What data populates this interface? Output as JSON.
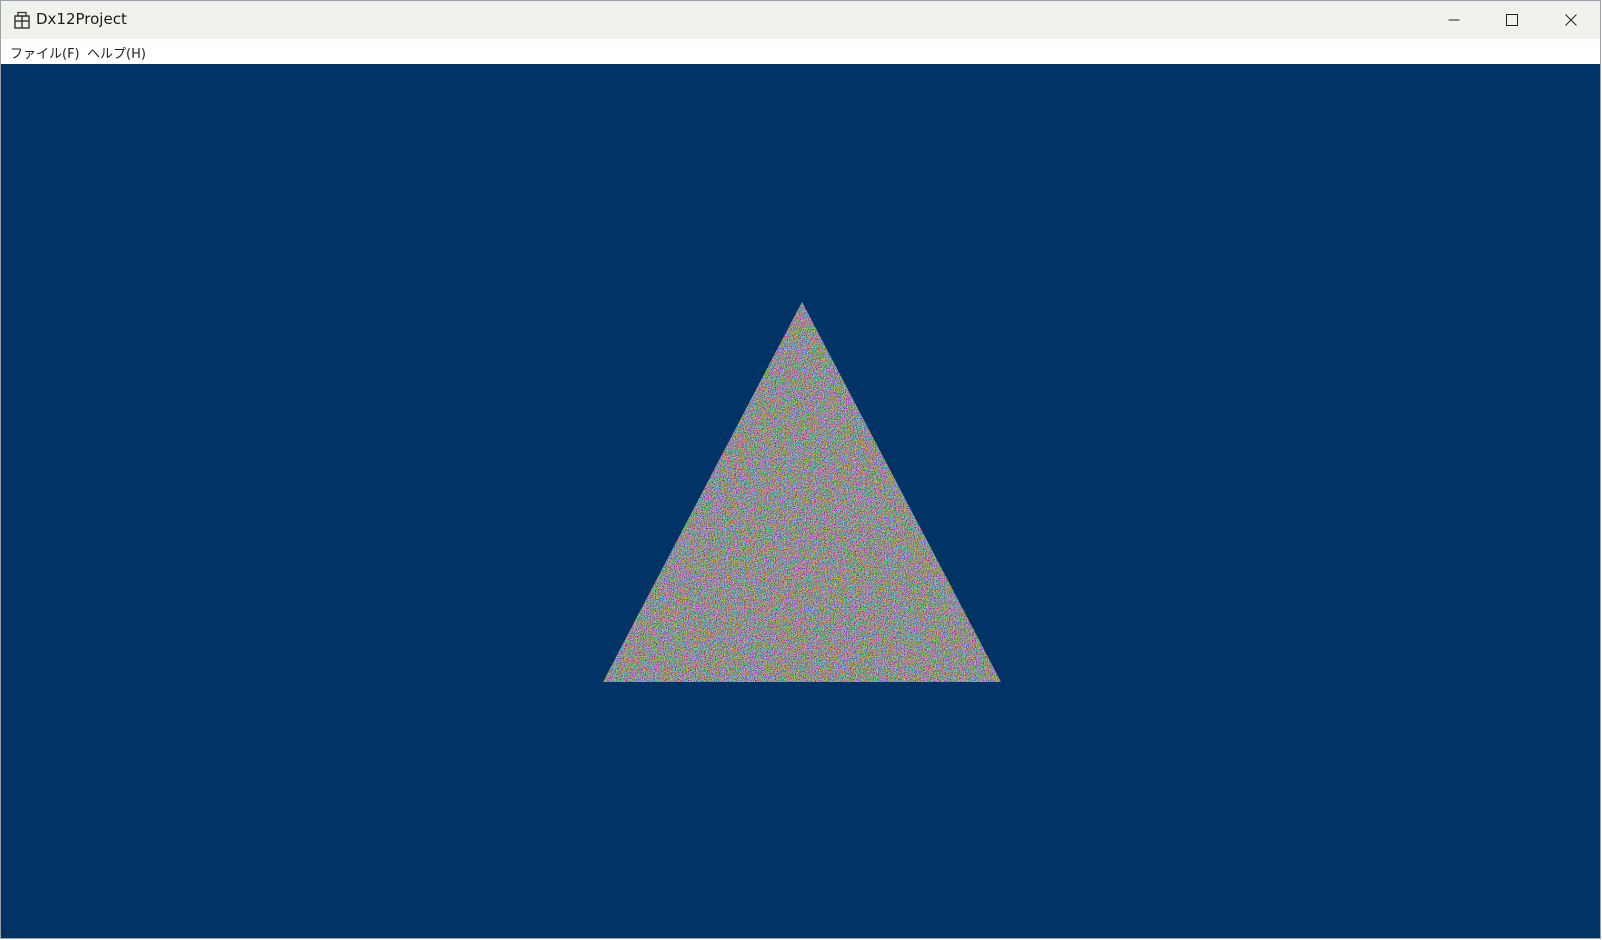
{
  "window": {
    "title": "Dx12Project",
    "icon": "app-window-icon"
  },
  "caption_buttons": {
    "minimize_icon": "minimize-icon",
    "maximize_icon": "maximize-icon",
    "close_icon": "close-icon"
  },
  "menubar": {
    "items": [
      {
        "label": "ファイル(F)"
      },
      {
        "label": "ヘルプ(H)"
      }
    ]
  },
  "viewport": {
    "clear_color": "#003366",
    "content": "noise-textured-triangle"
  }
}
